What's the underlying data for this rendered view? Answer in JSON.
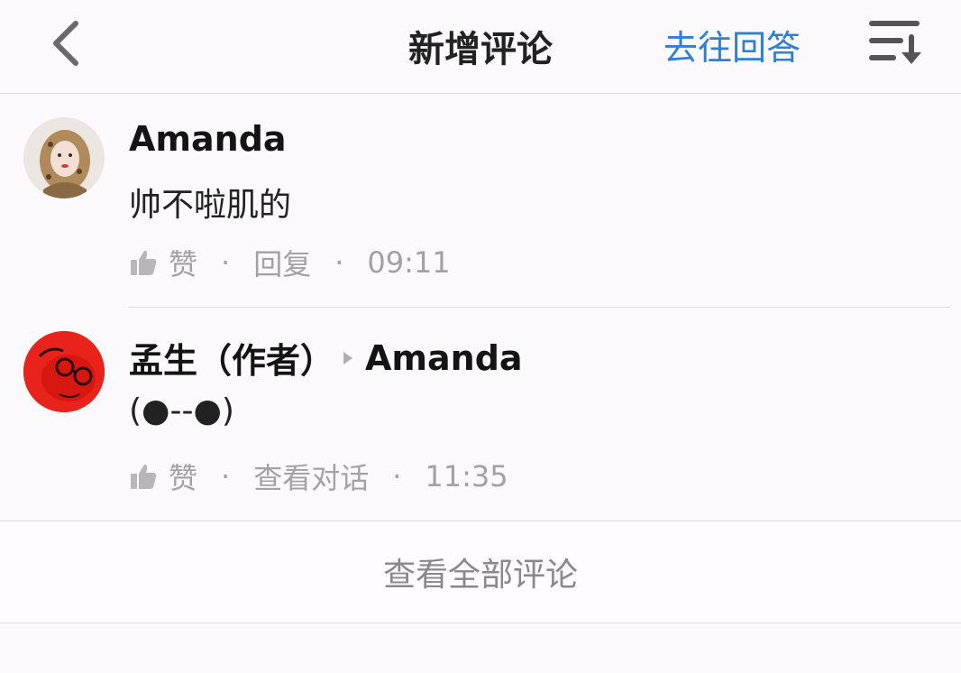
{
  "header": {
    "title": "新增评论",
    "action_label": "去往回答"
  },
  "comments": [
    {
      "author": "Amanda",
      "text": "帅不啦肌的",
      "like_label": "赞",
      "action_label": "回复",
      "time": "09:11",
      "avatar_color": "#f1ece8"
    },
    {
      "author": "孟生（作者）",
      "reply_to": "Amanda",
      "text": "(●--●)",
      "like_label": "赞",
      "action_label": "查看对话",
      "time": "11:35",
      "avatar_color": "#e8231c"
    }
  ],
  "footer": {
    "view_all_label": "查看全部评论"
  },
  "colors": {
    "accent": "#2f7fd6",
    "muted": "#a3a1a3"
  }
}
